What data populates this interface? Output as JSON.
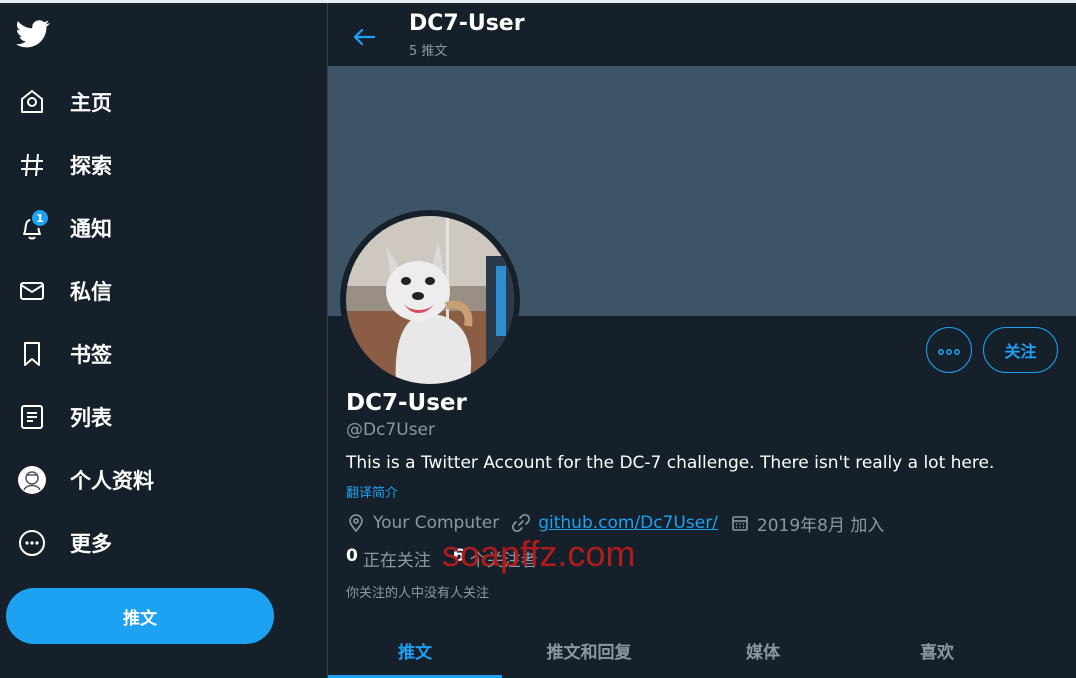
{
  "sidebar": {
    "logo": "twitter-bird-icon",
    "items": [
      {
        "label": "主页",
        "icon": "home-icon"
      },
      {
        "label": "探索",
        "icon": "hashtag-icon"
      },
      {
        "label": "通知",
        "icon": "bell-icon",
        "badge": "1"
      },
      {
        "label": "私信",
        "icon": "mail-icon"
      },
      {
        "label": "书签",
        "icon": "bookmark-icon"
      },
      {
        "label": "列表",
        "icon": "list-icon"
      },
      {
        "label": "个人资料",
        "icon": "avatar-icon"
      },
      {
        "label": "更多",
        "icon": "more-circle-icon"
      }
    ],
    "tweet_button": "推文"
  },
  "header": {
    "name": "DC7-User",
    "tweet_count": "5 推文"
  },
  "profile": {
    "name": "DC7-User",
    "handle": "@Dc7User",
    "bio": "This is a Twitter Account for the DC-7 challenge. There isn't really a lot here.",
    "translate": "翻译简介",
    "location": "Your Computer",
    "link": "github.com/Dc7User/",
    "joined": "2019年8月 加入",
    "follow_button": "关注",
    "following_count": "0",
    "following_label": "正在关注",
    "followers_count": "6",
    "followers_label": "个关注者",
    "no_mutual": "你关注的人中没有人关注"
  },
  "watermark": "soapffz.com",
  "tabs": [
    {
      "label": "推文",
      "active": true
    },
    {
      "label": "推文和回复",
      "active": false
    },
    {
      "label": "媒体",
      "active": false
    },
    {
      "label": "喜欢",
      "active": false
    }
  ],
  "colors": {
    "background": "#15202b",
    "accent": "#1da1f2",
    "banner": "#3d5466",
    "secondary_text": "#8899a6",
    "watermark": "#b01c1c"
  }
}
